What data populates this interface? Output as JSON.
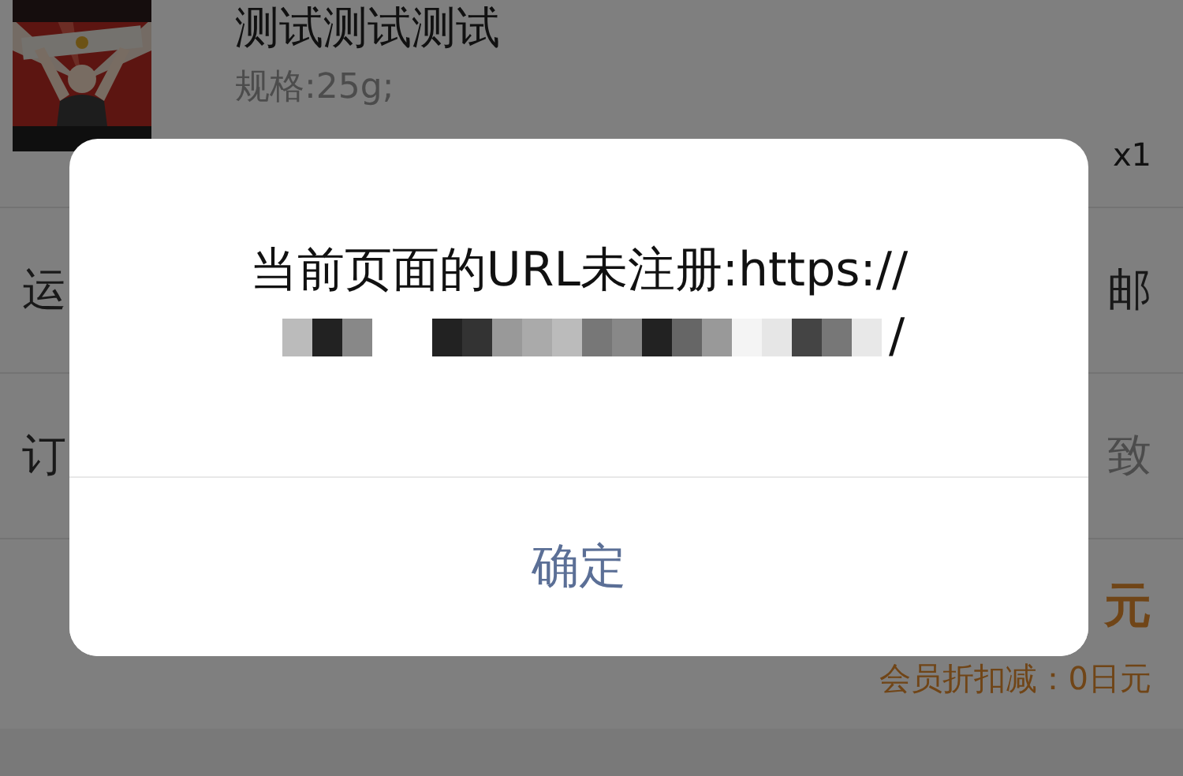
{
  "product": {
    "title": "测试测试测试",
    "spec": "规格:25g;",
    "quantity": "x1"
  },
  "rows": [
    {
      "label": "运",
      "value": "邮"
    },
    {
      "label": "订",
      "value": "致"
    }
  ],
  "totals": {
    "amount": "元",
    "discount": "会员折扣减：0日元"
  },
  "dialog": {
    "message": "当前页面的URL未注册:https://",
    "message_tail": "/",
    "buttons": [
      "确定"
    ]
  }
}
